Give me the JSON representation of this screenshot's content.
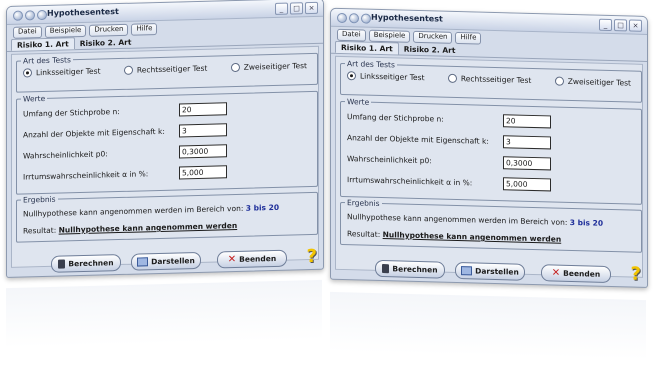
{
  "window": {
    "title": "Hypothesentest",
    "controls": {
      "minimize": "_",
      "maximize": "□",
      "close": "×"
    }
  },
  "menu": [
    "Datei",
    "Beispiele",
    "Drucken",
    "Hilfe"
  ],
  "tabs": [
    "Risiko 1. Art",
    "Risiko 2. Art"
  ],
  "art": {
    "legend": "Art des Tests",
    "options": [
      "Linksseitiger Test",
      "Rechtsseitiger Test",
      "Zweiseitiger Test"
    ],
    "selected": "Linksseitiger Test"
  },
  "werte": {
    "legend": "Werte",
    "fields": [
      {
        "label": "Umfang der Stichprobe n:",
        "value": "20"
      },
      {
        "label": "Anzahl der Objekte mit Eigenschaft k:",
        "value": "3"
      },
      {
        "label": "Wahrscheinlichkeit p0:",
        "value": "0,3000"
      },
      {
        "label": "Irrtumswahrscheinlichkeit α in %:",
        "value": "5,000"
      }
    ]
  },
  "ergebnis": {
    "legend": "Ergebnis",
    "line1_prefix": "Nullhypothese kann angenommen werden im Bereich von:",
    "line1_range": "3 bis 20",
    "line2_prefix": "Resultat:",
    "line2_result": "Nullhypothese kann angenommen werden"
  },
  "buttons": {
    "berechnen": "Berechnen",
    "darstellen": "Darstellen",
    "beenden": "Beenden",
    "help": "?"
  },
  "icons": {
    "berechnen": "calculator-icon",
    "darstellen": "image-icon",
    "beenden": "close-x-icon",
    "help": "question-mark-icon"
  },
  "colors": {
    "window_bg": "#d4dcea",
    "result_blue": "#1f2f9a",
    "close_red": "#c41e1e",
    "help_yellow": "#f2c400"
  }
}
